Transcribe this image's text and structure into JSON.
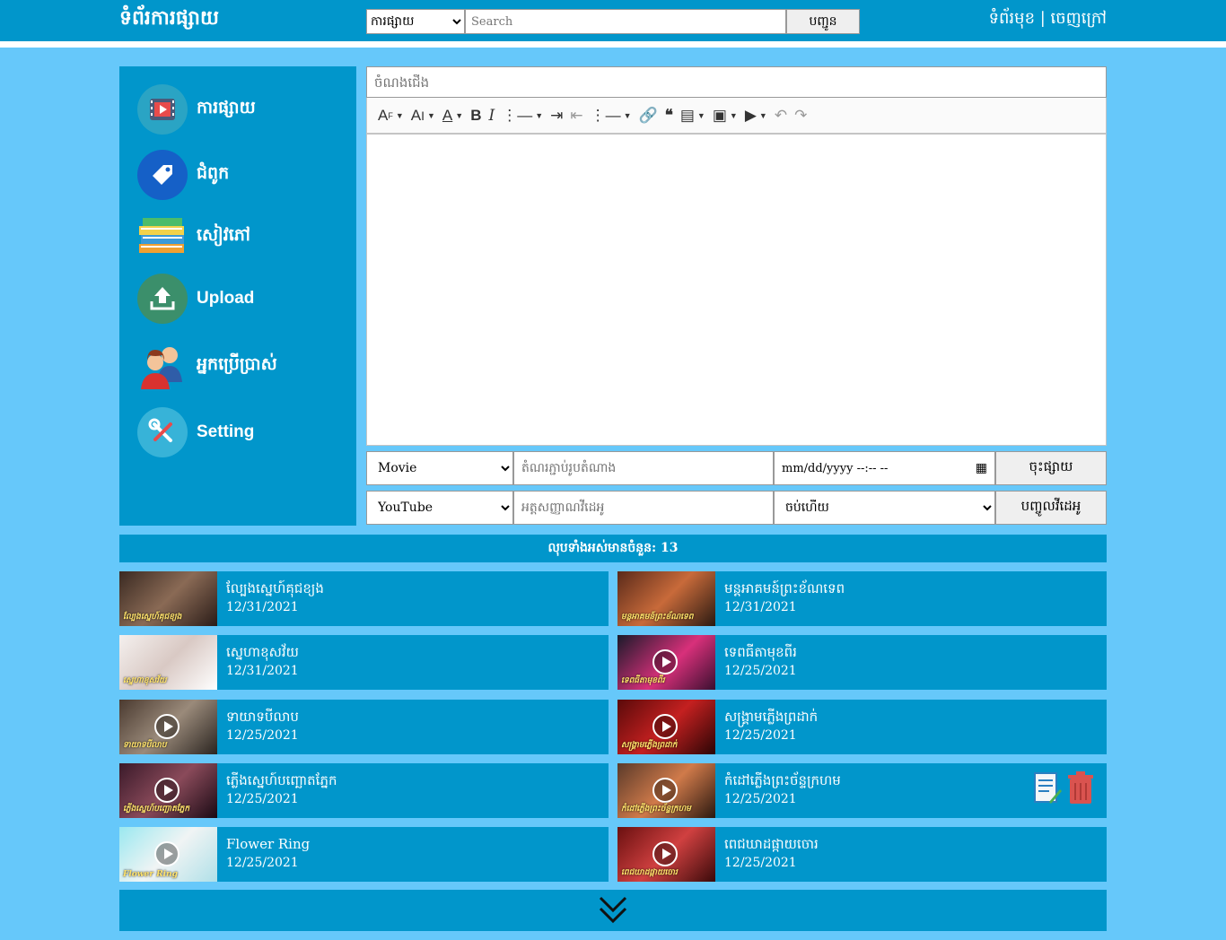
{
  "header": {
    "site_title": "ទំព័រការផ្សាយ",
    "category_selected": "ការផ្សាយ",
    "search_placeholder": "Search",
    "search_button": "បញ្ជូន",
    "links_text": "ទំព័រមុខ | ចេញក្រៅ"
  },
  "sidebar": {
    "items": [
      {
        "label": "ការផ្សាយ",
        "icon": "video-icon"
      },
      {
        "label": "ជំពូក",
        "icon": "tag-icon"
      },
      {
        "label": "សៀវភៅ",
        "icon": "books-icon"
      },
      {
        "label": "Upload",
        "icon": "upload-icon"
      },
      {
        "label": "អ្នកប្រើប្រាស់",
        "icon": "users-icon"
      },
      {
        "label": "Setting",
        "icon": "tools-icon"
      }
    ]
  },
  "editor": {
    "title_placeholder": "ចំណងជើង",
    "toolbar": [
      "text-style",
      "font-size",
      "font-color",
      "bold",
      "italic",
      "bulleted-list",
      "indent",
      "outdent",
      "numbered-list",
      "link",
      "blockquote",
      "source",
      "image",
      "media",
      "undo",
      "redo"
    ]
  },
  "form": {
    "type_selected": "Movie",
    "thumbnail_placeholder": "តំណរភ្ជាប់រូបតំណាង",
    "datetime_placeholder": "mm/dd/yyyy --:-- --",
    "publish_button": "ចុះផ្សាយ",
    "source_selected": "YouTube",
    "video_id_placeholder": "អត្តសញ្ញាណវីដេអូ",
    "status_selected": "ចប់ហើយ",
    "add_video_button": "បញ្ចូលវីដេអូ"
  },
  "list": {
    "count_text": "លុបទាំងអស់មានចំនួន: 13",
    "items": [
      {
        "title": "ល្បែងស្នេហ៍គុជខ្យង",
        "date": "12/31/2021",
        "thumb_caption": "ល្បែងស្នេហ៍គុជខ្យង",
        "play": false
      },
      {
        "title": "មន្តអាគមន៍ព្រះខ័ណទេព",
        "date": "12/31/2021",
        "thumb_caption": "មន្តអាគមន៍ព្រះខ័ណទេព",
        "play": false
      },
      {
        "title": "ស្នេហាខុសវ័យ",
        "date": "12/31/2021",
        "thumb_caption": "ស្នេហាខុសវ័យ",
        "play": false
      },
      {
        "title": "ទេពធីតាមុខពីរ",
        "date": "12/25/2021",
        "thumb_caption": "ទេពធីតាមុខពីរ",
        "play": true
      },
      {
        "title": "ទាយាទបីលាប",
        "date": "12/25/2021",
        "thumb_caption": "ទាយាទបីលាប",
        "play": true
      },
      {
        "title": "សង្គ្រាមភ្លើងព្រដាក់",
        "date": "12/25/2021",
        "thumb_caption": "សង្គ្រាមភ្លើងព្រដាក់",
        "play": true
      },
      {
        "title": "ភ្លើងស្នេហ៍បញ្ឆោតភ្នែក",
        "date": "12/25/2021",
        "thumb_caption": "ភ្លើងស្នេហ៍បញ្ឆោតភ្នែក",
        "play": true
      },
      {
        "title": "កំដៅភ្លើងព្រះច័ន្ទក្រហម",
        "date": "12/25/2021",
        "thumb_caption": "កំដៅភ្លើងព្រះច័ន្ទក្រហម",
        "play": true
      },
      {
        "title": "Flower Ring",
        "date": "12/25/2021",
        "thumb_caption": "Flower Ring",
        "play": true
      },
      {
        "title": "ពេជឃាដផ្កាយចោរ",
        "date": "12/25/2021",
        "thumb_caption": "ពេជឃាដផ្កាយចោរ",
        "play": true
      }
    ]
  },
  "colors": {
    "primary": "#0196cb",
    "background": "#66c8fa",
    "edit_icon": "#2a7fc1",
    "delete_icon": "#d9534f"
  }
}
